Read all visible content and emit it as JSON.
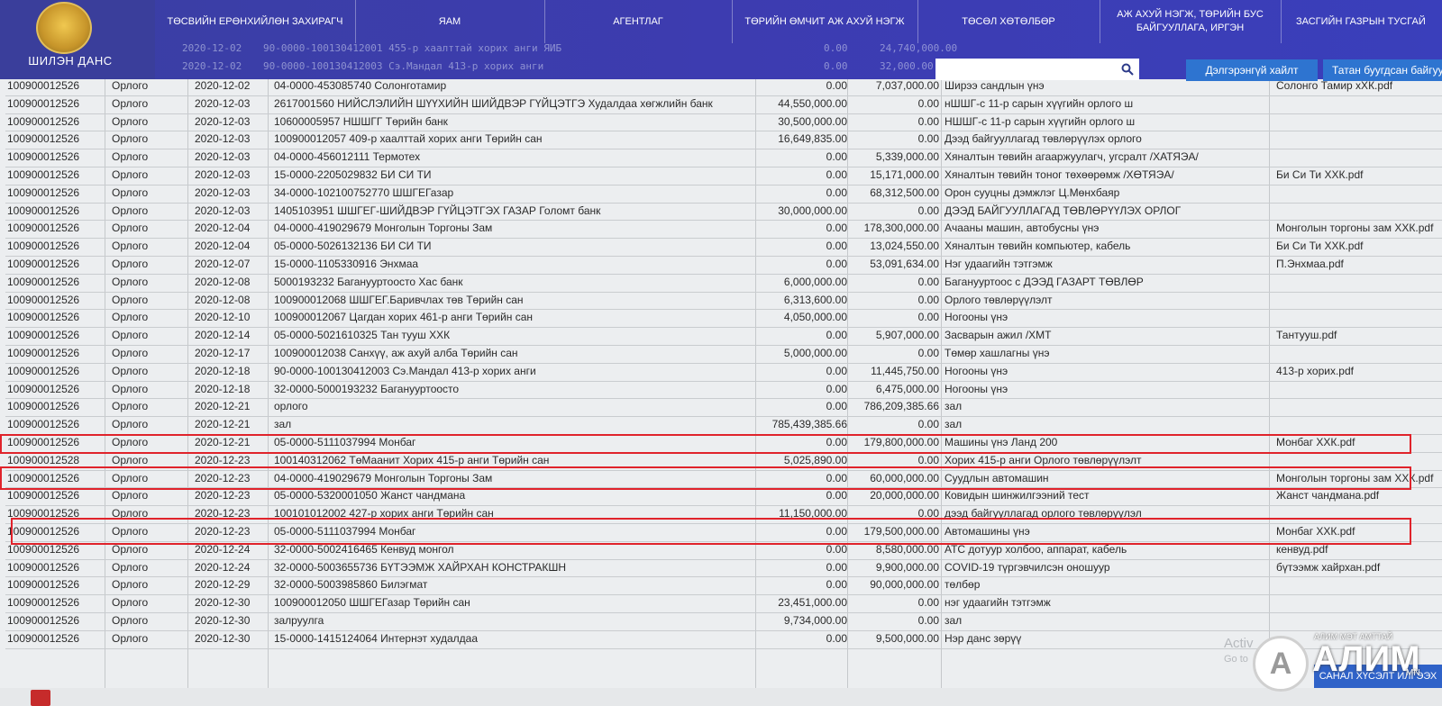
{
  "header": {
    "logo_title": "ШИЛЭН ДАНС",
    "nav": [
      "ТӨСВИЙН ЕРӨНХИЙЛӨН ЗАХИРАГЧ",
      "ЯАМ",
      "АГЕНТЛАГ",
      "ТӨРИЙН ӨМЧИТ АЖ АХУЙ НЭГЖ",
      "ТӨСӨЛ ХӨТӨЛБӨР",
      "АЖ АХУЙ НЭГЖ, ТӨРИЙН БУС БАЙГУУЛЛАГА, ИРГЭН",
      "ЗАСГИЙН ГАЗРЫН ТУСГАЙ"
    ],
    "ghost_rows": [
      {
        "date": "2020-12-02",
        "partner": "90-0000-100130412001 455-р хаалттай хорих анги ЯИБ",
        "in": "0.00",
        "out": "24,740,000.00"
      },
      {
        "date": "2020-12-02",
        "partner": "90-0000-100130412003 Сэ.Мандал 413-р хорих анги",
        "in": "0.00",
        "out": "32,000.00"
      }
    ],
    "search_placeholder": "",
    "advanced_search": "Дэлгэрэнгүй хайлт",
    "docs_button": "Татан буугдсан байгууллага"
  },
  "rows": [
    {
      "acc": "100900012526",
      "type": "Орлого",
      "date": "2020-12-02",
      "partner": "04-0000-453085740 Солонготамир",
      "in": "0.00",
      "out": "7,037,000.00",
      "desc": "Ширээ сандлын үнэ",
      "file": "Солонго Тамир хХК.pdf"
    },
    {
      "acc": "100900012526",
      "type": "Орлого",
      "date": "2020-12-03",
      "partner": "2617001560 НИЙСЛЭЛИЙН ШҮҮХИЙН ШИЙДВЭР ГҮЙЦЭТГЭ Худалдаа хөгжлийн банк",
      "in": "44,550,000.00",
      "out": "0.00",
      "desc": "нШШГ-с 11-р сарын хүүгийн орлого ш",
      "file": ""
    },
    {
      "acc": "100900012526",
      "type": "Орлого",
      "date": "2020-12-03",
      "partner": "10600005957 НШШГГ Төрийн банк",
      "in": "30,500,000.00",
      "out": "0.00",
      "desc": "НШШГ-с 11-р сарын хүүгийн орлого ш",
      "file": ""
    },
    {
      "acc": "100900012526",
      "type": "Орлого",
      "date": "2020-12-03",
      "partner": "100900012057 409-р хаалттай хорих анги Төрийн сан",
      "in": "16,649,835.00",
      "out": "0.00",
      "desc": "Дээд байгууллагад төвлөрүүлэх орлого",
      "file": ""
    },
    {
      "acc": "100900012526",
      "type": "Орлого",
      "date": "2020-12-03",
      "partner": "04-0000-456012111 Термотех",
      "in": "0.00",
      "out": "5,339,000.00",
      "desc": "Хяналтын төвийн агааржуулагч, угсралт /ХАТЯЭА/",
      "file": ""
    },
    {
      "acc": "100900012526",
      "type": "Орлого",
      "date": "2020-12-03",
      "partner": "15-0000-2205029832 БИ СИ ТИ",
      "in": "0.00",
      "out": "15,171,000.00",
      "desc": "Хяналтын төвийн тоног төхөөрөмж /ХӨТЯЭА/",
      "file": "Би Си Ти ХХК.pdf"
    },
    {
      "acc": "100900012526",
      "type": "Орлого",
      "date": "2020-12-03",
      "partner": "34-0000-102100752770 ШШГЕГазар",
      "in": "0.00",
      "out": "68,312,500.00",
      "desc": "Орон сууцны дэмжлэг Ц.Мөнхбаяр",
      "file": ""
    },
    {
      "acc": "100900012526",
      "type": "Орлого",
      "date": "2020-12-03",
      "partner": "1405103951 ШШГЕГ-ШИЙДВЭР ГҮЙЦЭТГЭХ ГАЗАР Голомт банк",
      "in": "30,000,000.00",
      "out": "0.00",
      "desc": "ДЭЭД БАЙГУУЛЛАГАД ТӨВЛӨРҮҮЛЭХ ОРЛОГ",
      "file": ""
    },
    {
      "acc": "100900012526",
      "type": "Орлого",
      "date": "2020-12-04",
      "partner": "04-0000-419029679 Монголын Торгоны Зам",
      "in": "0.00",
      "out": "178,300,000.00",
      "desc": "Ачааны машин, автобусны үнэ",
      "file": "Монголын торгоны зам ХХК.pdf"
    },
    {
      "acc": "100900012526",
      "type": "Орлого",
      "date": "2020-12-04",
      "partner": "05-0000-5026132136 БИ СИ ТИ",
      "in": "0.00",
      "out": "13,024,550.00",
      "desc": "Хяналтын төвийн компьютер, кабель",
      "file": "Би Си Ти ХХК.pdf"
    },
    {
      "acc": "100900012526",
      "type": "Орлого",
      "date": "2020-12-07",
      "partner": "15-0000-1105330916 Энхмаа",
      "in": "0.00",
      "out": "53,091,634.00",
      "desc": "Нэг удаагийн тэтгэмж",
      "file": "П.Энхмаа.pdf"
    },
    {
      "acc": "100900012526",
      "type": "Орлого",
      "date": "2020-12-08",
      "partner": "5000193232 Баганууртоосто Хас банк",
      "in": "6,000,000.00",
      "out": "0.00",
      "desc": "Баганууртоос с ДЭЭД ГАЗАРТ ТӨВЛӨР",
      "file": ""
    },
    {
      "acc": "100900012526",
      "type": "Орлого",
      "date": "2020-12-08",
      "partner": "100900012068 ШШГЕГ.Баривчлах төв Төрийн сан",
      "in": "6,313,600.00",
      "out": "0.00",
      "desc": "Орлого төвлөрүүлэлт",
      "file": ""
    },
    {
      "acc": "100900012526",
      "type": "Орлого",
      "date": "2020-12-10",
      "partner": "100900012067 Цагдан хорих 461-р анги Төрийн сан",
      "in": "4,050,000.00",
      "out": "0.00",
      "desc": "Ногооны үнэ",
      "file": ""
    },
    {
      "acc": "100900012526",
      "type": "Орлого",
      "date": "2020-12-14",
      "partner": "05-0000-5021610325 Тан тууш ХХК",
      "in": "0.00",
      "out": "5,907,000.00",
      "desc": "Засварын ажил /ХМТ",
      "file": "Тантууш.pdf"
    },
    {
      "acc": "100900012526",
      "type": "Орлого",
      "date": "2020-12-17",
      "partner": "100900012038 Санхүү, аж ахуй алба Төрийн сан",
      "in": "5,000,000.00",
      "out": "0.00",
      "desc": "Төмөр хашлагны үнэ",
      "file": ""
    },
    {
      "acc": "100900012526",
      "type": "Орлого",
      "date": "2020-12-18",
      "partner": "90-0000-100130412003 Сэ.Мандал 413-р хорих анги",
      "in": "0.00",
      "out": "11,445,750.00",
      "desc": "Ногооны үнэ",
      "file": "413-р хорих.pdf"
    },
    {
      "acc": "100900012526",
      "type": "Орлого",
      "date": "2020-12-18",
      "partner": "32-0000-5000193232 Баганууртоосто",
      "in": "0.00",
      "out": "6,475,000.00",
      "desc": "Ногооны үнэ",
      "file": ""
    },
    {
      "acc": "100900012526",
      "type": "Орлого",
      "date": "2020-12-21",
      "partner": "орлого",
      "in": "0.00",
      "out": "786,209,385.66",
      "desc": "зал",
      "file": ""
    },
    {
      "acc": "100900012526",
      "type": "Орлого",
      "date": "2020-12-21",
      "partner": "зал",
      "in": "785,439,385.66",
      "out": "0.00",
      "desc": "зал",
      "file": ""
    },
    {
      "acc": "100900012526",
      "type": "Орлого",
      "date": "2020-12-21",
      "partner": "05-0000-5111037994 Монбаг",
      "in": "0.00",
      "out": "179,800,000.00",
      "desc": "Машины үнэ Ланд 200",
      "file": "Монбаг ХХК.pdf"
    },
    {
      "acc": "100900012528",
      "type": "Орлого",
      "date": "2020-12-23",
      "partner": "100140312062 ТөМаанит Хорих 415-р анги Төрийн сан",
      "in": "5,025,890.00",
      "out": "0.00",
      "desc": "Хорих 415-р анги Орлого төвлөрүүлэлт",
      "file": ""
    },
    {
      "acc": "100900012526",
      "type": "Орлого",
      "date": "2020-12-23",
      "partner": "04-0000-419029679 Монголын Торгоны Зам",
      "in": "0.00",
      "out": "60,000,000.00",
      "desc": "Суудлын автомашин",
      "file": "Монголын торгоны зам ХХК.pdf"
    },
    {
      "acc": "100900012526",
      "type": "Орлого",
      "date": "2020-12-23",
      "partner": "05-0000-5320001050 Жанст чандмана",
      "in": "0.00",
      "out": "20,000,000.00",
      "desc": "Ковидын шинжилгээний тест",
      "file": "Жанст чандмана.pdf"
    },
    {
      "acc": "100900012526",
      "type": "Орлого",
      "date": "2020-12-23",
      "partner": "100101012002 427-р хорих анги Төрийн сан",
      "in": "11,150,000.00",
      "out": "0.00",
      "desc": "дээд байгууллагад орлого төвлөрүүлэл",
      "file": ""
    },
    {
      "acc": "100900012526",
      "type": "Орлого",
      "date": "2020-12-23",
      "partner": "05-0000-5111037994 Монбаг",
      "in": "0.00",
      "out": "179,500,000.00",
      "desc": "Автомашины үнэ",
      "file": "Монбаг ХХК.pdf"
    },
    {
      "acc": "100900012526",
      "type": "Орлого",
      "date": "2020-12-24",
      "partner": "32-0000-5002416465 Кенвуд монгол",
      "in": "0.00",
      "out": "8,580,000.00",
      "desc": "АТС дотуур холбоо, аппарат, кабель",
      "file": "кенвуд.pdf"
    },
    {
      "acc": "100900012526",
      "type": "Орлого",
      "date": "2020-12-24",
      "partner": "32-0000-5003655736 БҮТЭЭМЖ ХАЙРХАН КОНСТРАКШН",
      "in": "0.00",
      "out": "9,900,000.00",
      "desc": "COVID-19 түргэвчилсэн оношуур",
      "file": "бүтээмж хайрхан.pdf"
    },
    {
      "acc": "100900012526",
      "type": "Орлого",
      "date": "2020-12-29",
      "partner": "32-0000-5003985860 Билэгмат",
      "in": "0.00",
      "out": "90,000,000.00",
      "desc": "төлбөр",
      "file": ""
    },
    {
      "acc": "100900012526",
      "type": "Орлого",
      "date": "2020-12-30",
      "partner": "100900012050 ШШГЕГазар Төрийн сан",
      "in": "23,451,000.00",
      "out": "0.00",
      "desc": "нэг удаагийн тэтгэмж",
      "file": ""
    },
    {
      "acc": "100900012526",
      "type": "Орлого",
      "date": "2020-12-30",
      "partner": "залруулга",
      "in": "9,734,000.00",
      "out": "0.00",
      "desc": "зал",
      "file": ""
    },
    {
      "acc": "100900012526",
      "type": "Орлого",
      "date": "2020-12-30",
      "partner": "15-0000-1415124064 Интернэт худалдаа",
      "in": "0.00",
      "out": "9,500,000.00",
      "desc": "Нэр данс зөрүү",
      "file": ""
    }
  ],
  "watermark": {
    "small": "АЛИМ МЭТ АМТТАЙ",
    "big": "АЛИМ",
    "tld": "MN",
    "letter": "A"
  },
  "os_notice": {
    "line1": "Activ",
    "line2": "Go to"
  },
  "feedback_button": "САНАЛ ХҮСЭЛТ ИЛГЭЭХ"
}
